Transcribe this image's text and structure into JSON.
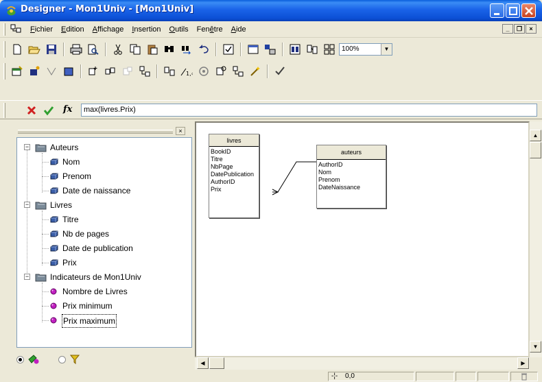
{
  "window": {
    "title": "Designer - Mon1Univ - [Mon1Univ]"
  },
  "menubar": {
    "items": [
      "Fichier",
      "Edition",
      "Affichage",
      "Insertion",
      "Outils",
      "Fenêtre",
      "Aide"
    ],
    "accel": [
      "F",
      "E",
      "A",
      "I",
      "O",
      "ê",
      "A"
    ]
  },
  "toolbar": {
    "zoom_value": "100%"
  },
  "formula": {
    "value": "max(livres.Prix)",
    "fx_label": "fx"
  },
  "tree": {
    "items": [
      {
        "label": "Auteurs",
        "type": "class"
      },
      {
        "label": "Nom",
        "type": "dimension"
      },
      {
        "label": "Prenom",
        "type": "dimension"
      },
      {
        "label": "Date de naissance",
        "type": "dimension"
      },
      {
        "label": "Livres",
        "type": "class"
      },
      {
        "label": "Titre",
        "type": "dimension"
      },
      {
        "label": "Nb de pages",
        "type": "dimension"
      },
      {
        "label": "Date de publication",
        "type": "dimension"
      },
      {
        "label": "Prix",
        "type": "dimension"
      },
      {
        "label": "Indicateurs de Mon1Univ",
        "type": "class"
      },
      {
        "label": "Nombre de Livres",
        "type": "measure"
      },
      {
        "label": "Prix minimum",
        "type": "measure"
      },
      {
        "label": "Prix maximum",
        "type": "measure",
        "selected": true
      }
    ]
  },
  "schema": {
    "tables": [
      {
        "name": "livres",
        "fields": [
          "BookID",
          "Titre",
          "NbPage",
          "DatePublication",
          "AuthorID",
          "Prix"
        ]
      },
      {
        "name": "auteurs",
        "fields": [
          "AuthorID",
          "Nom",
          "Prenom",
          "DateNaissance"
        ]
      }
    ]
  },
  "statusbar": {
    "coords": "0,0"
  },
  "colors": {
    "titlebar": "#1a63e8",
    "measure": "#c020c0",
    "dimension": "#3a5ea8",
    "class_folder": "#6b7b8c"
  }
}
